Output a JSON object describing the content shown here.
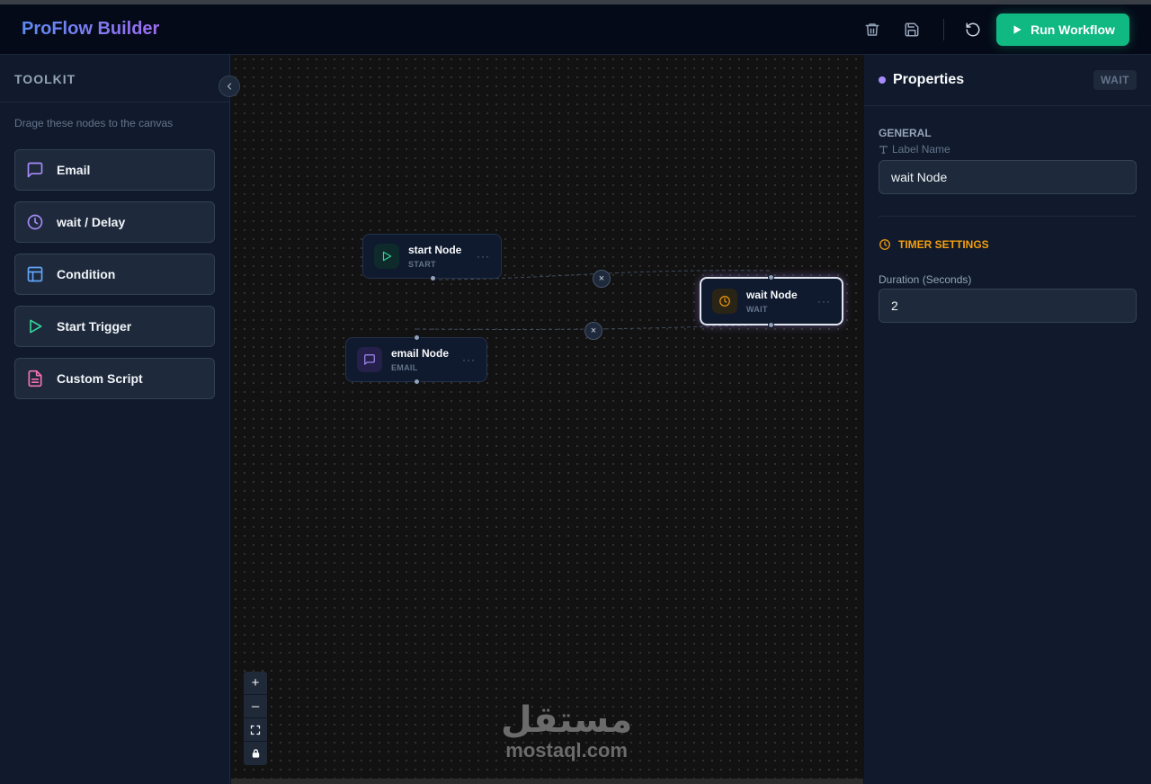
{
  "header": {
    "brand": "ProFlow Builder",
    "run_label": "Run Workflow",
    "icons": [
      "trash-icon",
      "save-icon",
      "undo-icon"
    ]
  },
  "sidebar": {
    "title": "TOOLKIT",
    "hint": "Drage these nodes to the canvas",
    "tools": [
      {
        "label": "Email",
        "icon": "message-icon",
        "color": "#a78bfa"
      },
      {
        "label": "wait / Delay",
        "icon": "clock-icon",
        "color": "#a78bfa"
      },
      {
        "label": "Condition",
        "icon": "layout-icon",
        "color": "#60a5fa"
      },
      {
        "label": "Start Trigger",
        "icon": "play-icon",
        "color": "#34d399"
      },
      {
        "label": "Custom Script",
        "icon": "file-icon",
        "color": "#f472b6"
      }
    ]
  },
  "canvas": {
    "nodes": [
      {
        "title": "start Node",
        "type": "START",
        "icon": "play-icon",
        "color": "#34d399"
      },
      {
        "title": "email Node",
        "type": "EMAIL",
        "icon": "message-icon",
        "color": "#a78bfa"
      },
      {
        "title": "wait Node",
        "type": "WAIT",
        "icon": "clock-icon",
        "color": "#f59e0b",
        "selected": true
      }
    ],
    "edge_delete_symbol": "×",
    "more_symbol": "···",
    "zoom_controls": [
      "+",
      "–",
      "fit-view-icon",
      "lock-icon"
    ]
  },
  "properties": {
    "title": "Properties",
    "badge": "WAIT",
    "general_label": "GENERAL",
    "label_name": "Label Name",
    "label_value": "wait Node",
    "timer_label": "TIMER SETTINGS",
    "duration_label": "Duration (Seconds)",
    "duration_value": "2"
  },
  "watermark": {
    "arabic": "مستقل",
    "latin": "mostaql.com"
  }
}
